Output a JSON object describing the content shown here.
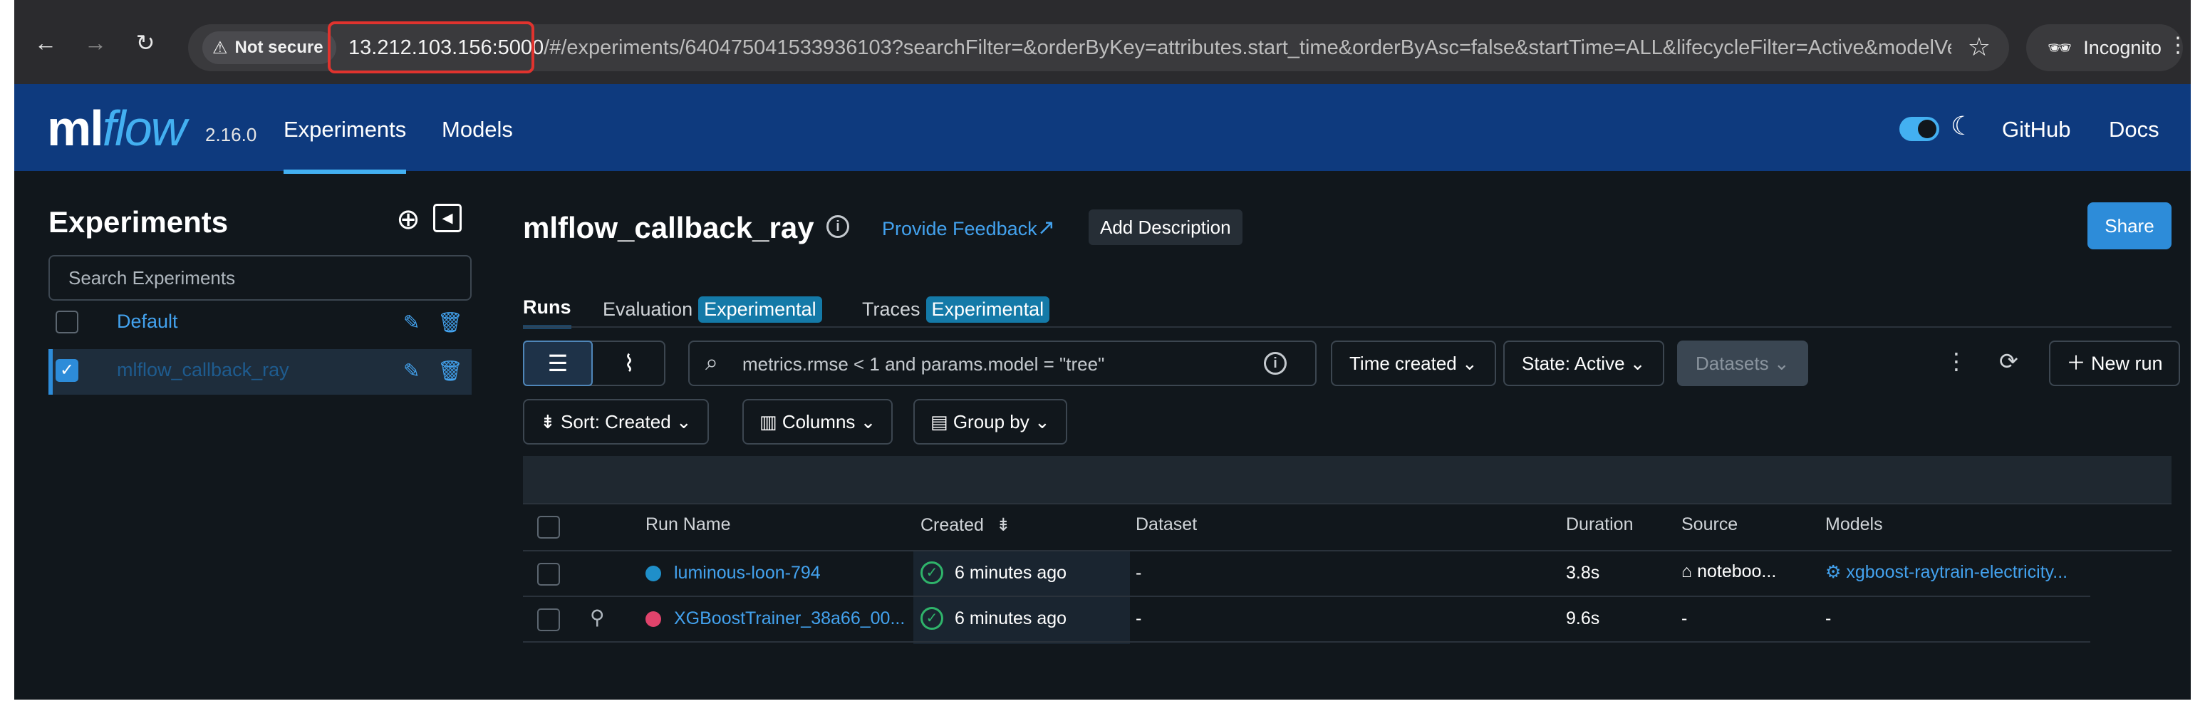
{
  "browser": {
    "security_label": "Not secure",
    "url_host": "13.212.103.156:5000",
    "url_path": "/#/experiments/640475041533936103?searchFilter=&orderByKey=attributes.start_time&orderByAsc=false&startTime=ALL&lifecycleFilter=Active&modelVersi...",
    "profile_label": "Incognito"
  },
  "header": {
    "logo_ml": "ml",
    "logo_flow": "flow",
    "version": "2.16.0",
    "nav": [
      {
        "label": "Experiments"
      },
      {
        "label": "Models"
      }
    ],
    "links": [
      {
        "label": "GitHub"
      },
      {
        "label": "Docs"
      }
    ],
    "accent": "#43b0f1",
    "background": "#0e3a7e"
  },
  "sidebar": {
    "title": "Experiments",
    "search_placeholder": "Search Experiments",
    "items": [
      {
        "name": "Default",
        "checked": false
      },
      {
        "name": "mlflow_callback_ray",
        "checked": true
      }
    ]
  },
  "main": {
    "title": "mlflow_callback_ray",
    "feedback_label": "Provide Feedback",
    "add_description_label": "Add Description",
    "share_label": "Share",
    "tabs": [
      {
        "label": "Runs",
        "tag": ""
      },
      {
        "label": "Evaluation",
        "tag": "Experimental"
      },
      {
        "label": "Traces",
        "tag": "Experimental"
      }
    ],
    "filter_placeholder": "metrics.rmse < 1 and params.model = \"tree\"",
    "dropdowns": {
      "time": "Time created",
      "state": "State: Active",
      "datasets": "Datasets"
    },
    "new_run_label": "New run",
    "sort_label": "Sort: Created",
    "columns_label": "Columns",
    "group_label": "Group by"
  },
  "table": {
    "columns": [
      "Run Name",
      "Created",
      "Dataset",
      "Duration",
      "Source",
      "Models"
    ],
    "rows": [
      {
        "color": "#1f8fc9",
        "run_name": "luminous-loon-794",
        "created": "6 minutes ago",
        "dataset": "-",
        "duration": "3.8s",
        "source": "noteboo...",
        "models": "xgboost-raytrain-electricity..."
      },
      {
        "color": "#e0436b",
        "run_name": "XGBoostTrainer_38a66_00...",
        "created": "6 minutes ago",
        "dataset": "-",
        "duration": "9.6s",
        "source": "-",
        "models": "-"
      }
    ]
  }
}
